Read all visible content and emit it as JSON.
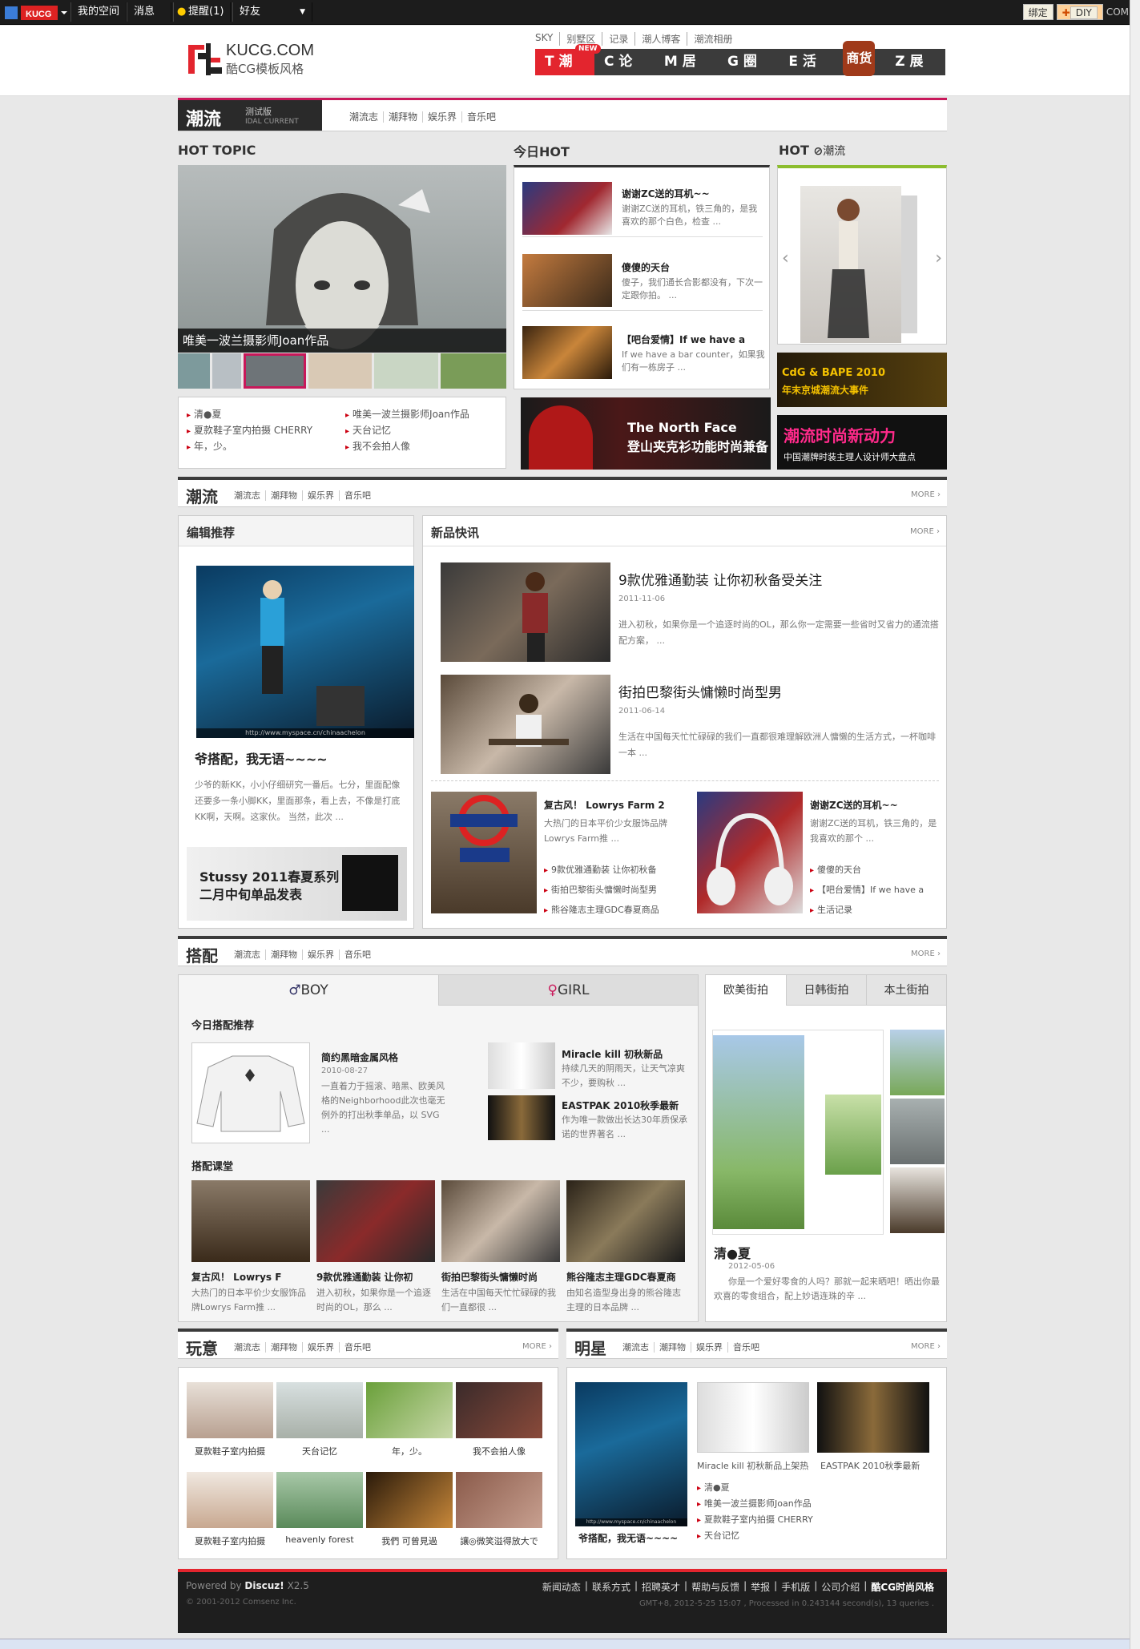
{
  "topbar": {
    "brand": "KUCG",
    "items": [
      "我的空间",
      "消息",
      "提醒(1)",
      "好友"
    ],
    "bind_label": "绑定",
    "diy_label": "DIY",
    "com_label": "COM"
  },
  "header": {
    "logo_title": "KUCG.COM",
    "logo_subtitle": "酷CG模板风格",
    "subnav": [
      "SKY",
      "别墅区",
      "记录",
      "潮人博客",
      "潮流相册"
    ],
    "mainnav": [
      "T 潮流",
      "C 论坛",
      "M 居民",
      "G 圈子",
      "E 活动",
      "Z 展览"
    ],
    "mainnav_badge": "NEW",
    "shop_label": "商货"
  },
  "channel": {
    "title": "潮流",
    "tag": "测试版",
    "sub": "IDAL CURRENT",
    "links": [
      "潮流志",
      "潮拜物",
      "娱乐界",
      "音乐吧"
    ]
  },
  "hot_topic": {
    "heading": "HOT TOPIC",
    "caption": "唯美一波兰摄影师Joan作品",
    "list_left": [
      "清●夏",
      "夏款鞋子室内拍摄 CHERRY",
      "年，少。"
    ],
    "list_right": [
      "唯美一波兰摄影师Joan作品",
      "天台记忆",
      "我不会拍人像"
    ]
  },
  "today_hot": {
    "heading": "今日HOT",
    "items": [
      {
        "title": "谢谢ZC送的耳机~~",
        "desc": "谢谢ZC送的耳机，铁三角的，是我喜欢的那个白色，检查 ..."
      },
      {
        "title": "傻傻的天台",
        "desc": "傻子，我们通长合影都没有，下次一定跟你拍。 ..."
      },
      {
        "title": "【吧台爱情】If we have a",
        "desc": "If we have a bar counter，如果我们有一栋房子 ..."
      }
    ],
    "banner_line1": "The North Face",
    "banner_line2": "登山夹克衫功能时尚兼备"
  },
  "hot_chao": {
    "heading": "HOT",
    "heading2": "潮流",
    "banner1_line1": "CdG & BAPE 2010",
    "banner1_line2": "年末京城潮流大事件",
    "banner2_line1": "潮流时尚新动力",
    "banner2_line2": "中国潮牌时装主理人设计师大盘点"
  },
  "section_chaoliu": {
    "title": "潮流",
    "links": [
      "潮流志",
      "潮拜物",
      "娱乐界",
      "音乐吧"
    ],
    "more": "MORE ›",
    "editor_heading": "编辑推荐",
    "editor_img_caption": "http://www.myspace.cn/chinaachelon",
    "editor_title": "爷搭配，我无语~~~~",
    "editor_desc": "少爷的新KK，小小仔细研究一番后。七分，里面配像还要多一条小脚KK，里面那条，看上去，不像是打底KK啊，天啊。这家伙。 当然，此次 ...",
    "editor_banner_line1": "Stussy 2011春夏系列",
    "editor_banner_line2": "二月中旬单品发表",
    "news_heading": "新品快讯",
    "news": [
      {
        "title": "9款优雅通勤装 让你初秋备受关注",
        "date": "2011-11-06",
        "desc": "进入初秋，如果你是一个追逐时尚的OL，那么你一定需要一些省时又省力的通流搭配方案， ..."
      },
      {
        "title": "街拍巴黎街头慵懒时尚型男",
        "date": "2011-06-14",
        "desc": "生活在中国每天忙忙碌碌的我们一直都很难理解欧洲人慵懒的生活方式，一杯咖啡一本 ..."
      }
    ],
    "col1_title": "复古风！ Lowrys Farm 2",
    "col1_desc": "大热门的日本平价少女服饰品牌Lowrys Farm推 ...",
    "col1_list": [
      "9款优雅通勤装 让你初秋备",
      "街拍巴黎街头慵懒时尚型男",
      "熊谷隆志主理GDC春夏商品"
    ],
    "col2_title": "谢谢ZC送的耳机~~",
    "col2_desc": "谢谢ZC送的耳机，铁三角的，是我喜欢的那个 ...",
    "col2_list": [
      "傻傻的天台",
      "【吧台爱情】If we have a",
      "生活记录"
    ]
  },
  "section_dapei": {
    "title": "搭配",
    "links": [
      "潮流志",
      "潮拜物",
      "娱乐界",
      "音乐吧"
    ],
    "more": "MORE ›",
    "tab_boy": "BOY",
    "tab_girl": "GIRL",
    "today_heading": "今日搭配推荐",
    "main_item": {
      "title": "简约黑暗金属风格",
      "date": "2010-08-27",
      "desc": "一直着力于摇滚、暗黑、欧美风格的Neighborhood此次也毫无例外的打出秋季单品，以 SVG ..."
    },
    "side_items": [
      {
        "title": "Miracle kill 初秋新品",
        "desc": "持续几天的阴雨天，让天气凉爽不少，要购秋 ..."
      },
      {
        "title": "EASTPAK 2010秋季最新",
        "desc": "作为唯一款做出长达30年质保承诺的世界著名 ..."
      }
    ],
    "class_heading": "搭配课堂",
    "class_items": [
      {
        "title": "复古风！ Lowrys F",
        "desc": "大热门的日本平价少女服饰品牌Lowrys Farm推 ..."
      },
      {
        "title": "9款优雅通勤装 让你初",
        "desc": "进入初秋，如果你是一个追逐时尚的OL，那么 ..."
      },
      {
        "title": "街拍巴黎街头慵懒时尚",
        "desc": "生活在中国每天忙忙碌碌的我们一直都很 ..."
      },
      {
        "title": "熊谷隆志主理GDC春夏商",
        "desc": "由知名造型身出身的熊谷隆志主理的日本品牌 ..."
      }
    ],
    "street_tabs": [
      "欧美街拍",
      "日韩街拍",
      "本土街拍"
    ],
    "street_title": "清●夏",
    "street_date": "2012-05-06",
    "street_desc": "你是一个爱好零食的人吗？那就一起来晒吧！晒出你最欢喜的零食组合，配上妙语连珠的辛 ..."
  },
  "section_wanyi": {
    "title": "玩意",
    "links": [
      "潮流志",
      "潮拜物",
      "娱乐界",
      "音乐吧"
    ],
    "more": "MORE ›",
    "items": [
      "夏款鞋子室内拍摄",
      "天台记忆",
      "年，少。",
      "我不会拍人像",
      "夏款鞋子室内拍摄",
      "heavenly forest",
      "我們 可曾見過",
      "讓◎微笑溢得放大で"
    ]
  },
  "section_mingxing": {
    "title": "明星",
    "links": [
      "潮流志",
      "潮拜物",
      "娱乐界",
      "音乐吧"
    ],
    "more": "MORE ›",
    "main_caption": "爷搭配，我无语~~~~",
    "main_img_caption": "http://www.myspace.cn/chinaachelon",
    "item1": "Miracle kill 初秋新品上架热",
    "item2": "EASTPAK 2010秋季最新",
    "list": [
      "清●夏",
      "唯美一波兰摄影师Joan作品",
      "夏款鞋子室内拍摄 CHERRY",
      "天台记忆"
    ]
  },
  "footer": {
    "powered": "Powered by",
    "brand": "Discuz!",
    "version": "X2.5",
    "copyright": "© 2001-2012 Comsenz Inc.",
    "links": [
      "新闻动态",
      "联系方式",
      "招聘英才",
      "帮助与反馈",
      "举报",
      "手机版",
      "公司介绍",
      "酷CG时尚风格"
    ],
    "stats": "GMT+8, 2012-5-25 15:07 , Processed in 0.243144 second(s), 13 queries ."
  },
  "colors": {
    "accent": "#e3252e",
    "dark": "#3a3a3a",
    "pink": "#c8185a"
  }
}
